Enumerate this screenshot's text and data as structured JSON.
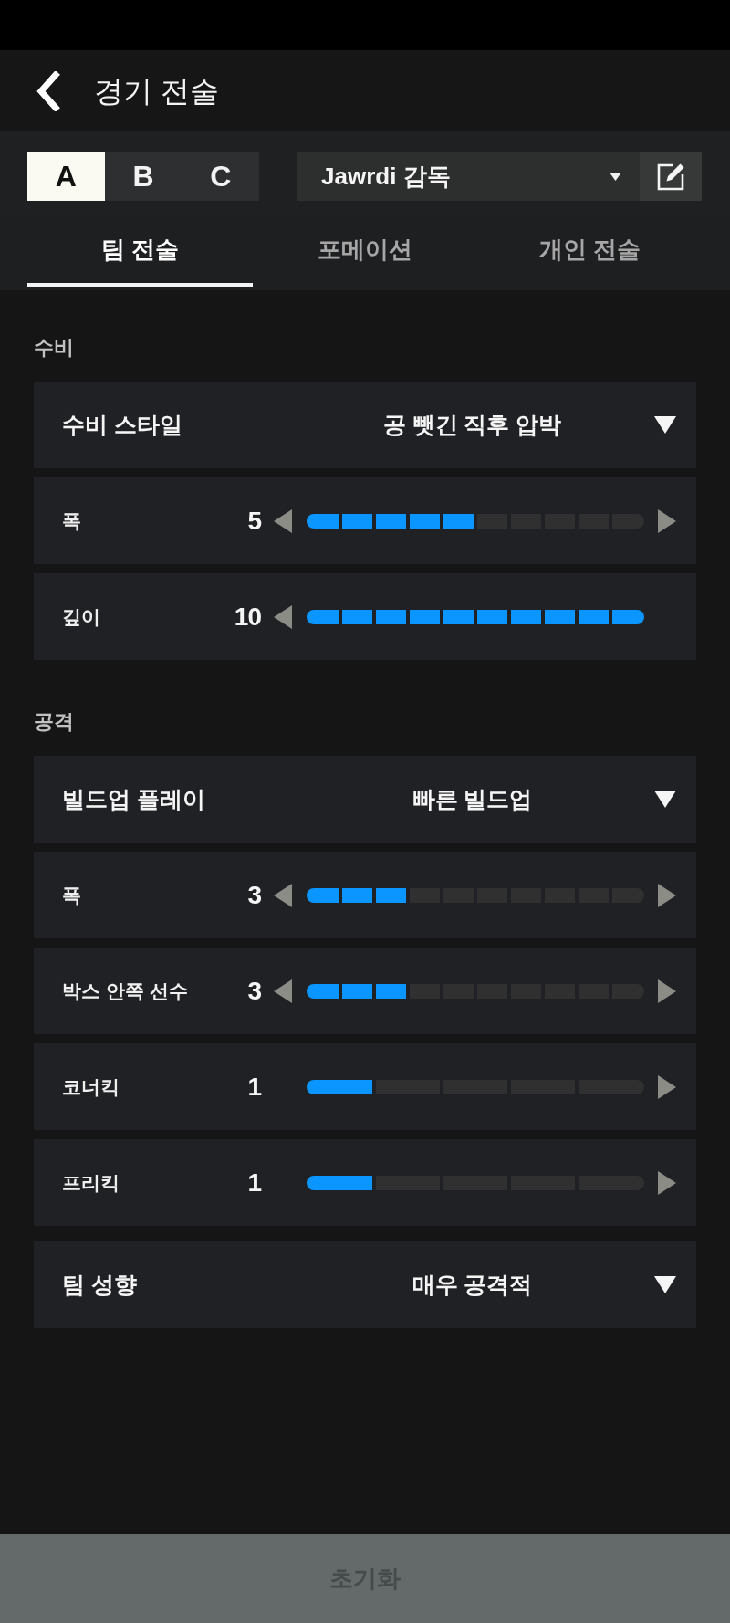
{
  "header": {
    "title": "경기 전술"
  },
  "presets": [
    {
      "label": "A",
      "selected": true
    },
    {
      "label": "B",
      "selected": false
    },
    {
      "label": "C",
      "selected": false
    }
  ],
  "manager_select": {
    "value": "Jawrdi 감독"
  },
  "tabs": [
    {
      "label": "팀 전술",
      "selected": true
    },
    {
      "label": "포메이션",
      "selected": false
    },
    {
      "label": "개인 전술",
      "selected": false
    }
  ],
  "sections": [
    {
      "title": "수비",
      "settings": [
        {
          "kind": "select",
          "label": "수비 스타일",
          "value": "공 뺏긴 직후 압박"
        },
        {
          "kind": "slider10",
          "label": "폭",
          "value": "5",
          "level": 0.5,
          "can_decrease": true,
          "can_increase": true
        },
        {
          "kind": "slider10",
          "label": "깊이",
          "value": "10",
          "level": 1,
          "can_decrease": true,
          "can_increase": false
        }
      ]
    },
    {
      "title": "공격",
      "settings": [
        {
          "kind": "select",
          "label": "빌드업 플레이",
          "value": "빠른 빌드업"
        },
        {
          "kind": "slider10",
          "label": "폭",
          "value": "3",
          "level": 0.3,
          "can_decrease": true,
          "can_increase": true
        },
        {
          "kind": "slider10",
          "label": "박스 안쪽 선수",
          "value": "3",
          "level": 0.3,
          "can_decrease": true,
          "can_increase": true
        },
        {
          "kind": "slider5",
          "label": "코너킥",
          "value": "1",
          "level": 0.2,
          "can_decrease": false,
          "can_increase": true
        },
        {
          "kind": "slider5",
          "label": "프리킥",
          "value": "1",
          "level": 0.2,
          "can_decrease": false,
          "can_increase": true
        },
        {
          "kind": "select",
          "label": "팀 성향",
          "value": "매우 공격적"
        }
      ]
    }
  ],
  "reset_button": {
    "label": "초기화",
    "disabled": true
  }
}
